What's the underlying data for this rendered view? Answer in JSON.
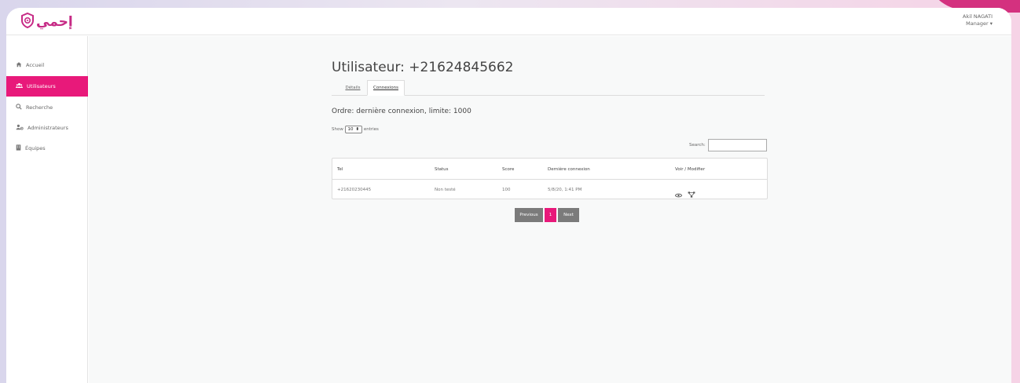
{
  "app": {
    "logo_text": "إحمي",
    "user_name": "Akil NAGATI",
    "user_role": "Manager"
  },
  "sidebar": {
    "items": [
      {
        "label": "Accueil",
        "icon": "home-icon",
        "active": false
      },
      {
        "label": "Utilisateurs",
        "icon": "users-icon",
        "active": true
      },
      {
        "label": "Recherche",
        "icon": "search-icon",
        "active": false
      },
      {
        "label": "Administrateurs",
        "icon": "admin-users-icon",
        "active": false
      },
      {
        "label": "Équipes",
        "icon": "building-icon",
        "active": false
      }
    ]
  },
  "main": {
    "title": "Utilisateur: +21624845662",
    "tabs": [
      {
        "label": "Détails",
        "active": false
      },
      {
        "label": "Connexions",
        "active": true
      }
    ],
    "order_text": "Ordre: dernière connexion, limite: 1000",
    "show_label": "Show",
    "entries_value": "10",
    "entries_label": "entries",
    "search_label": "Search:",
    "search_value": ""
  },
  "table": {
    "headers": [
      "Tel",
      "Status",
      "Score",
      "Dernière connexion",
      "Voir / Modifier"
    ],
    "rows": [
      {
        "tel": "+21620230445",
        "status": "Non testé",
        "score": "100",
        "last": "5/8/20, 1:41 PM"
      }
    ]
  },
  "pagination": {
    "previous": "Previous",
    "current": "1",
    "next": "Next"
  },
  "colors": {
    "accent": "#e8197a",
    "brand": "#c62a85",
    "pager_gray": "#7b7b7b"
  }
}
